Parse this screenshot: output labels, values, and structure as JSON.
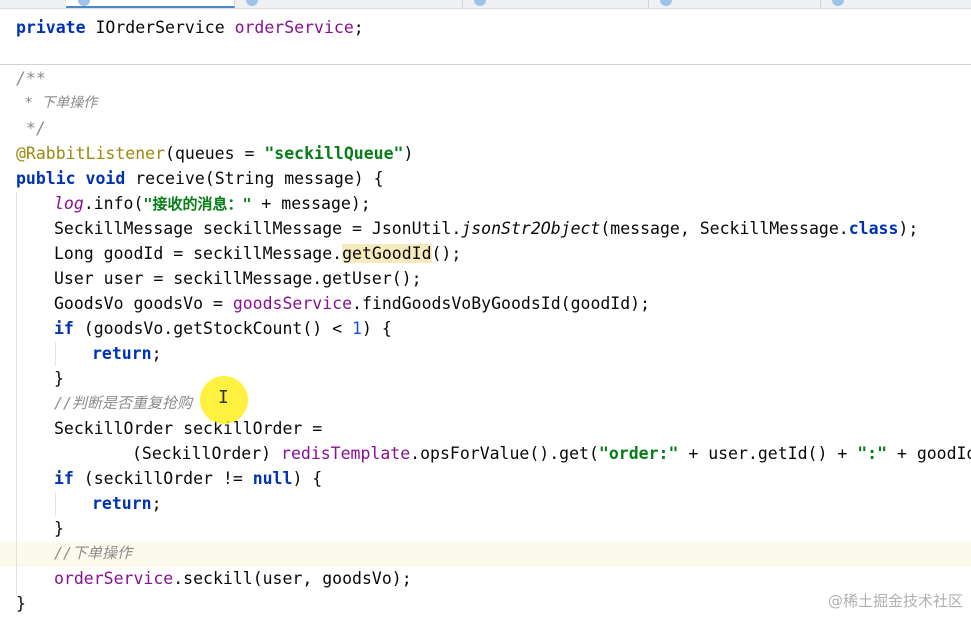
{
  "tabs": [
    {
      "label": ""
    },
    {
      "label": ""
    },
    {
      "label": ""
    },
    {
      "label": ""
    },
    {
      "label": ""
    },
    {
      "label": ""
    }
  ],
  "code": {
    "line_field": {
      "kw": "private",
      "type": "IOrderService",
      "field": "orderService",
      "end": ";"
    },
    "javadoc_open": "/**",
    "javadoc_text": " * 下单操作",
    "javadoc_close": " */",
    "annotation": {
      "name": "@RabbitListener",
      "open": "(queues = ",
      "value": "\"seckillQueue\"",
      "close": ")"
    },
    "signature": {
      "kw1": "public",
      "kw2": "void",
      "rest": " receive(String message) {"
    },
    "log_line": {
      "field": "log",
      "call": ".info(",
      "str": "\"接收的消息：\"",
      "rest": " + message);"
    },
    "seckill_msg_line": {
      "pre": "SeckillMessage seckillMessage = JsonUtil.",
      "stat": "jsonStr2Object",
      "mid": "(message, SeckillMessage.",
      "kw": "class",
      "end": ");"
    },
    "goodid_line": {
      "pre": "Long goodId = seckillMessage.",
      "hl": "getGoodId",
      "end": "();"
    },
    "user_line": "User user = seckillMessage.getUser();",
    "goodsvo_line": {
      "pre": "GoodsVo goodsVo = ",
      "field": "goodsService",
      "end": ".findGoodsVoByGoodsId(goodId);"
    },
    "if1_line": {
      "kw": "if",
      "pre": " (goodsVo.getStockCount() < ",
      "num": "1",
      "end": ") {"
    },
    "return1": {
      "kw": "return",
      "end": ";"
    },
    "close1": "}",
    "comment1": "//判断是否重复抢购",
    "seckill_order_line": "SeckillOrder seckillOrder =",
    "redis_line": {
      "pre": "(SeckillOrder) ",
      "field": "redisTemplate",
      "mid": ".opsForValue().get(",
      "str1": "\"order:\"",
      "mid2": " + user.getId() + ",
      "str2": "\":\"",
      "end": " + goodId);"
    },
    "if2_line": {
      "kw": "if",
      "pre": " (seckillOrder != ",
      "kw2": "null",
      "end": ") {"
    },
    "return2": {
      "kw": "return",
      "end": ";"
    },
    "close2": "}",
    "comment2": "//下单操作",
    "seckill_call": {
      "field": "orderService",
      "end": ".seckill(user, goodsVo);"
    },
    "close_method": "}"
  },
  "cursor_glyph": "I",
  "watermark": "@稀土掘金技术社区",
  "colors": {
    "keyword": "#0033b3",
    "field": "#871094",
    "string": "#067d17",
    "annotation": "#9e880d",
    "comment": "#8c8c8c",
    "number": "#1750eb"
  }
}
